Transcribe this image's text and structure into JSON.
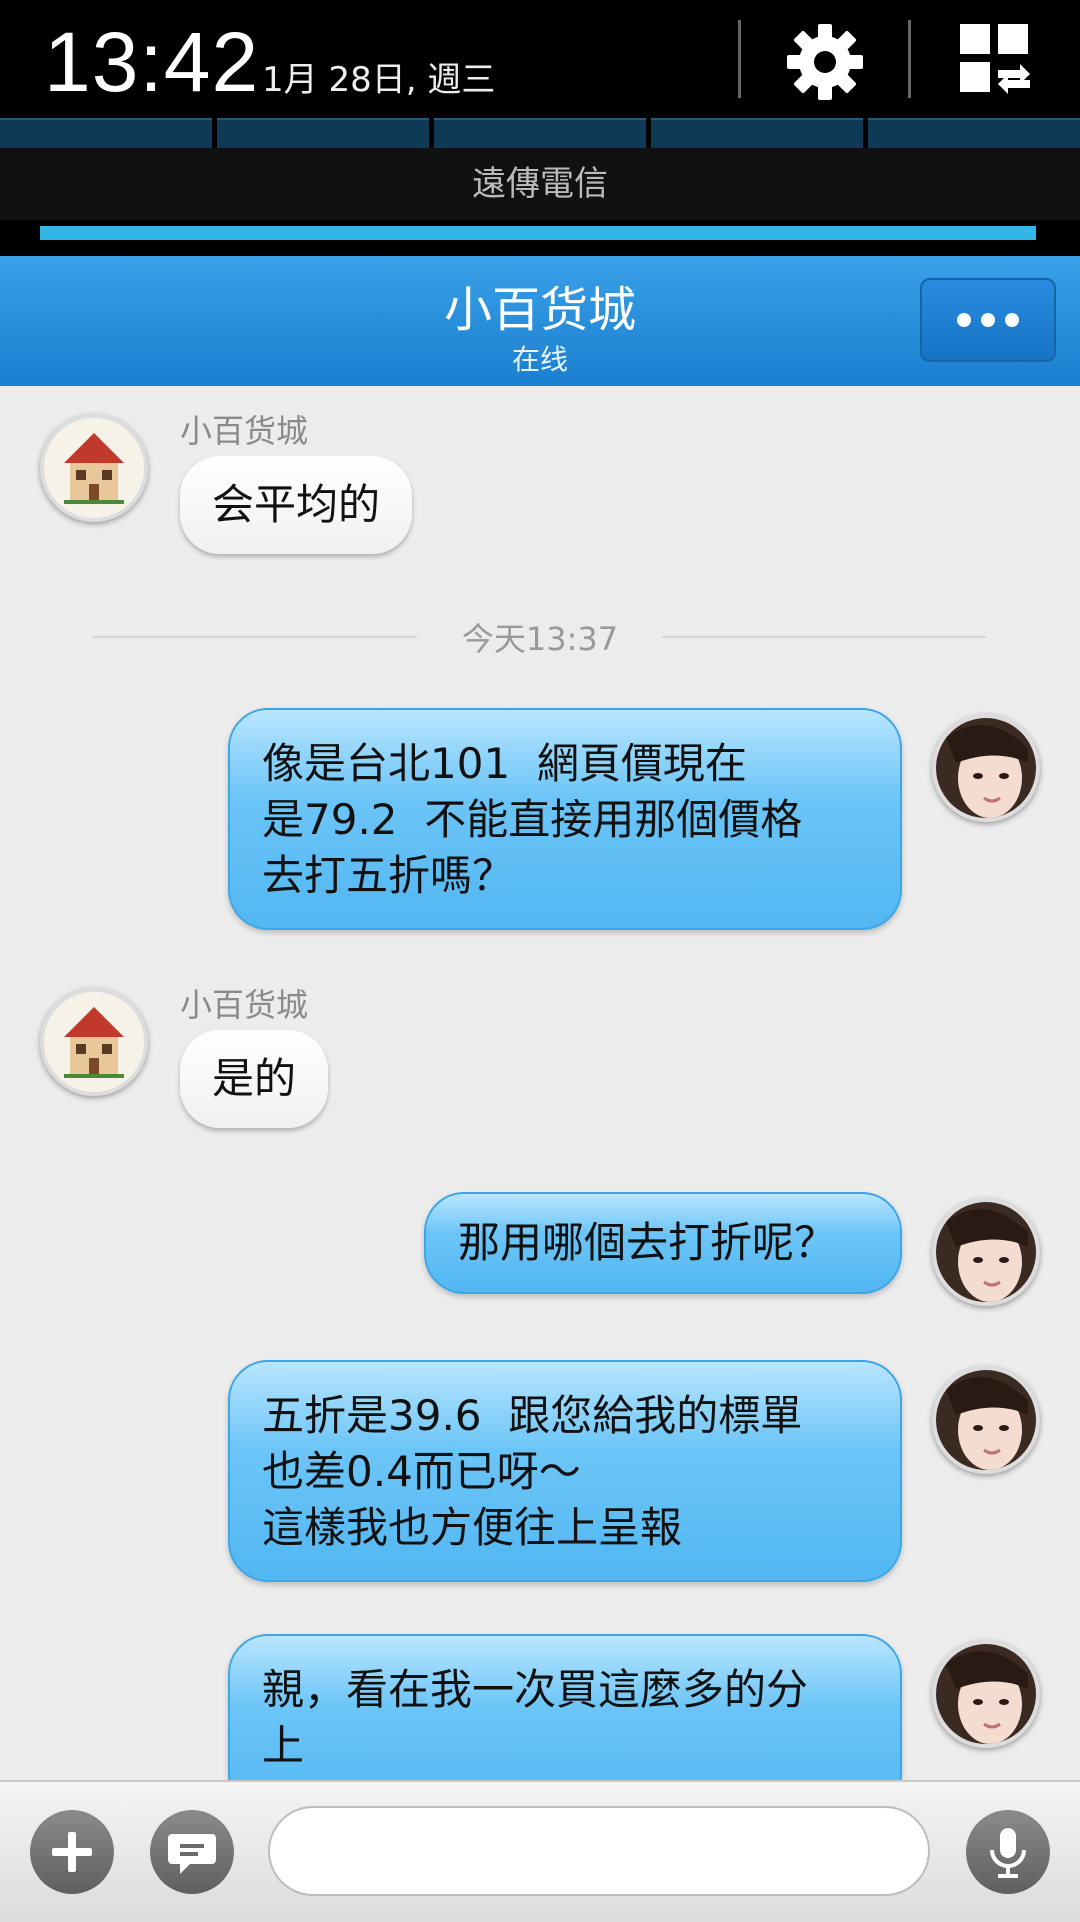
{
  "status_bar": {
    "time": "13:42",
    "date": "1月 28日, 週三",
    "carrier": "遠傳電信",
    "icons": [
      "gear-icon",
      "grid-toggle-icon"
    ]
  },
  "header": {
    "title": "小百货城",
    "status": "在线",
    "more_icon": "more-dots-icon"
  },
  "messages": [
    {
      "direction": "in",
      "sender": "小百货城",
      "text": "会平均的"
    },
    {
      "type": "timestamp",
      "text": "今天13:37"
    },
    {
      "direction": "out",
      "text": "像是台北101  網頁價現在\n是79.2  不能直接用那個價格\n去打五折嗎？"
    },
    {
      "direction": "in",
      "sender": "小百货城",
      "text": "是的"
    },
    {
      "direction": "out",
      "text": "那用哪個去打折呢？"
    },
    {
      "direction": "out",
      "text": "五折是39.6  跟您給我的標單\n也差0.4而已呀～\n這樣我也方便往上呈報"
    },
    {
      "direction": "out",
      "text": "親，看在我一次買這麼多的分\n上"
    }
  ],
  "input_bar": {
    "placeholder": "",
    "icons": [
      "plus-icon",
      "emoticon-icon",
      "microphone-icon"
    ]
  },
  "colors": {
    "header": "#2a8fdc",
    "outgoing_bubble": "#5ebdf4",
    "incoming_bubble": "#ffffff",
    "background": "#ececec",
    "brightness_bar": "#33b5e5"
  }
}
